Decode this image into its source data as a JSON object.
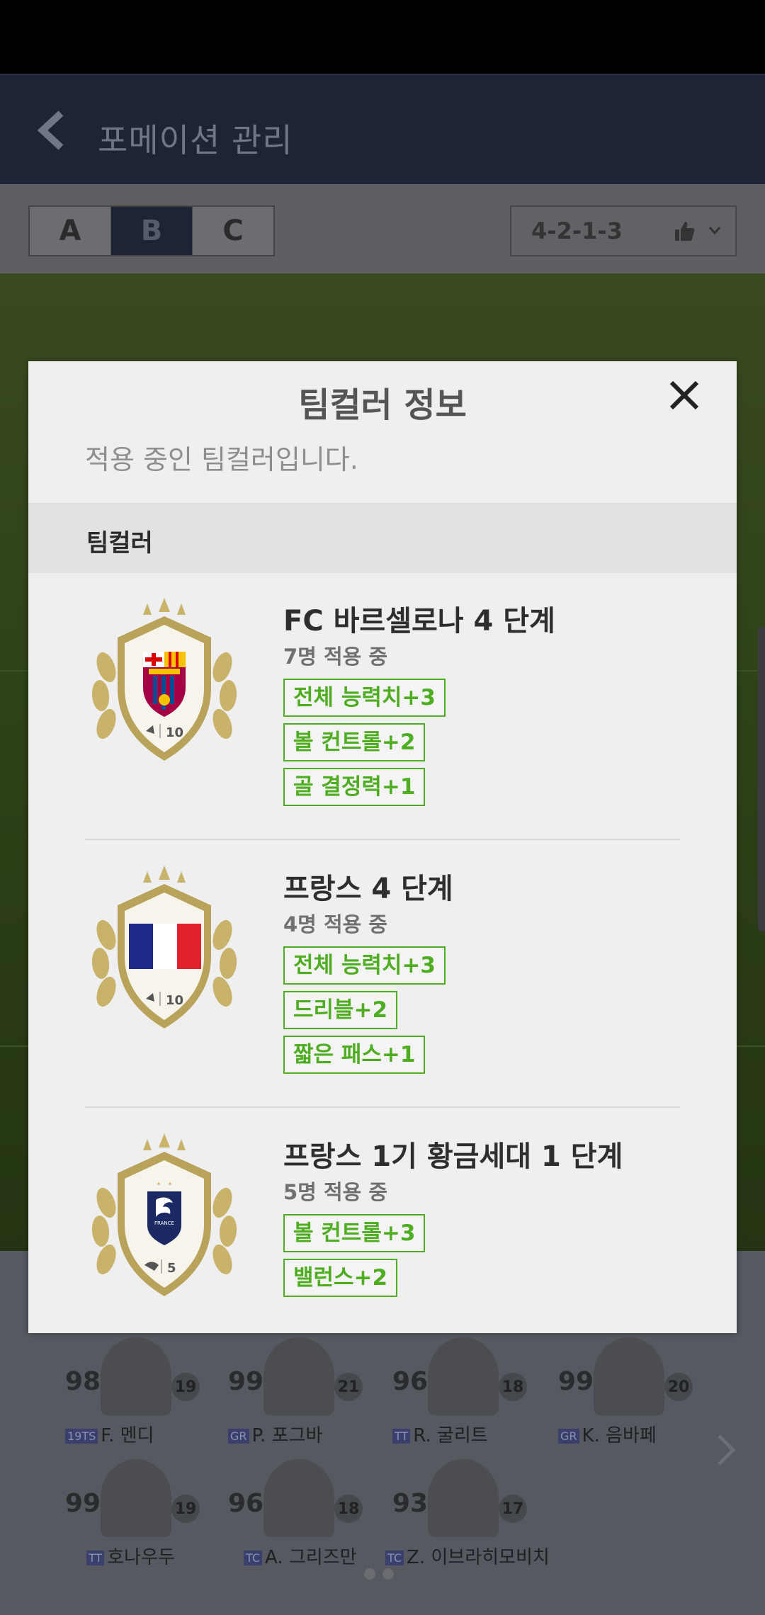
{
  "app": {
    "title": "포메이션 관리",
    "tabs": [
      "A",
      "B",
      "C"
    ],
    "active_tab": "B",
    "formation": "4-2-1-3"
  },
  "bench": [
    {
      "rating": "98",
      "badge": "19TS",
      "name": "F. 멘디",
      "num": "19"
    },
    {
      "rating": "99",
      "badge": "GR",
      "name": "P. 포그바",
      "num": "21"
    },
    {
      "rating": "96",
      "badge": "TT",
      "name": "R. 굴리트",
      "num": "18"
    },
    {
      "rating": "99",
      "badge": "GR",
      "name": "K. 음바페",
      "num": "20"
    },
    {
      "rating": "99",
      "badge": "TT",
      "name": "호나우두",
      "num": "19"
    },
    {
      "rating": "96",
      "badge": "TC",
      "name": "A. 그리즈만",
      "num": "18"
    },
    {
      "rating": "93",
      "badge": "TC",
      "name": "Z. 이브라히모비치",
      "num": "17"
    }
  ],
  "modal": {
    "title": "팀컬러 정보",
    "subtitle": "적용 중인 팀컬러입니다.",
    "section": "팀컬러",
    "items": [
      {
        "name": "FC 바르셀로나 4 단계",
        "count": "7명 적용 중",
        "emblem": "fc-barcelona-crest",
        "level": "10",
        "bonuses": [
          "전체 능력치+3",
          "볼 컨트롤+2",
          "골 결정력+1"
        ]
      },
      {
        "name": "프랑스 4 단계",
        "count": "4명 적용 중",
        "emblem": "france-flag",
        "level": "10",
        "bonuses": [
          "전체 능력치+3",
          "드리블+2",
          "짧은 패스+1"
        ]
      },
      {
        "name": "프랑스 1기 황금세대 1 단계",
        "count": "5명 적용 중",
        "emblem": "france-fff-crest",
        "level": "5",
        "bonuses": [
          "볼 컨트롤+3",
          "밸런스+2"
        ]
      }
    ]
  },
  "colors": {
    "bonus_green": "#4fad22",
    "appbar": "#1d2436",
    "laurel_gold": "#c9b26a"
  }
}
